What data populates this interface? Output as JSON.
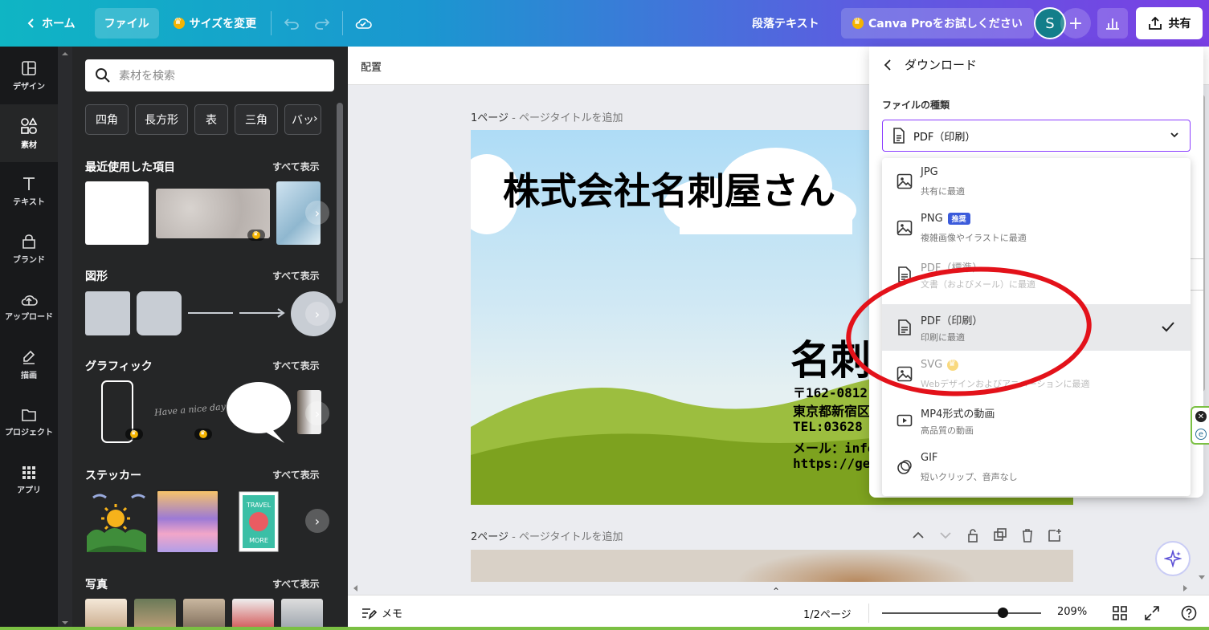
{
  "topbar": {
    "home_label": "ホーム",
    "file_label": "ファイル",
    "resize_label": "サイズを変更",
    "doc_title": "段落テキスト",
    "pro_label": "Canva Proをお試しください",
    "avatar_letter": "S",
    "share_label": "共有"
  },
  "rail": {
    "items": [
      {
        "label": "デザイン",
        "icon": "layout-icon"
      },
      {
        "label": "素材",
        "icon": "shapes-icon"
      },
      {
        "label": "テキスト",
        "icon": "text-icon"
      },
      {
        "label": "ブランド",
        "icon": "brand-icon"
      },
      {
        "label": "アップロード",
        "icon": "upload-icon"
      },
      {
        "label": "描画",
        "icon": "draw-icon"
      },
      {
        "label": "プロジェクト",
        "icon": "folder-icon"
      },
      {
        "label": "アプリ",
        "icon": "apps-icon"
      }
    ]
  },
  "panel": {
    "search_placeholder": "素材を検索",
    "chips": [
      "四角",
      "長方形",
      "表",
      "三角",
      "バッ"
    ],
    "see_all": "すべて表示",
    "sections": {
      "recent": "最近使用した項目",
      "shapes": "図形",
      "graphics": "グラフィック",
      "stickers": "ステッカー",
      "photos": "写真"
    },
    "graphic_script_text": "Have a nice day"
  },
  "canvas": {
    "arrange_label": "配置",
    "page1_label": "1ページ",
    "page2_label": "2ページ",
    "page_title_hint": "ページタイトルを追加",
    "card": {
      "company": "株式会社名刺屋さん",
      "name": "名刺",
      "lines": [
        "〒162-0812",
        "東京都新宿区",
        "TEL:03628",
        "メール：info@",
        "https://geki"
      ]
    }
  },
  "bottombar": {
    "memo_label": "メモ",
    "page_count": "1/2ページ",
    "zoom": "209%",
    "zoom_level_fraction": 0.76
  },
  "download": {
    "title": "ダウンロード",
    "file_type_label": "ファイルの種類",
    "selected_value": "PDF（印刷）",
    "options": [
      {
        "name": "JPG",
        "desc": "共有に最適",
        "icon": "image-icon"
      },
      {
        "name": "PNG",
        "desc": "複雑画像やイラストに最適",
        "badge": "推奨",
        "icon": "image-icon"
      },
      {
        "name": "PDF（標準）",
        "desc": "文書（およびメール）に最適",
        "icon": "document-icon"
      },
      {
        "name": "PDF（印刷）",
        "desc": "印刷に最適",
        "icon": "document-icon",
        "selected": true
      },
      {
        "name": "SVG",
        "desc": "Webデザインおよびアニメーションに最適",
        "icon": "image-icon",
        "pro": true
      },
      {
        "name": "MP4形式の動画",
        "desc": "高品質の動画",
        "icon": "video-icon"
      },
      {
        "name": "GIF",
        "desc": "短いクリップ、音声なし",
        "icon": "gif-icon"
      }
    ]
  },
  "colors": {
    "accent": "#8b3dff",
    "annotation": "#e3121a",
    "topbar_start": "#0fb5c4",
    "topbar_end": "#7a3fe4"
  }
}
